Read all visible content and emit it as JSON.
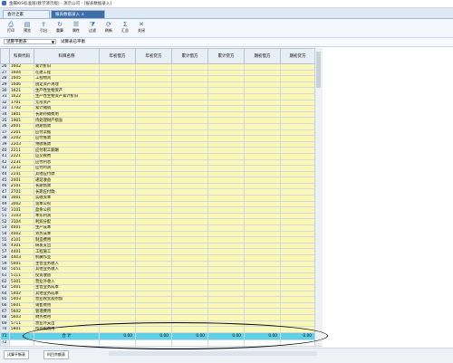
{
  "window": {
    "title": "金蝶KIS标准版(教学演示版) - 演示公司 - [报表数据录入]"
  },
  "tabs": [
    {
      "label": "会计之家"
    },
    {
      "label": "报表数据录入 ×"
    }
  ],
  "toolbar": [
    {
      "label": "打印",
      "icon": "printer-icon",
      "glyph": "⎙"
    },
    {
      "label": "预览",
      "icon": "preview-icon",
      "glyph": "▤"
    },
    {
      "label": "引出",
      "icon": "export-icon",
      "glyph": "⇪"
    },
    {
      "label": "重算",
      "icon": "recalc-icon",
      "glyph": "↻"
    },
    {
      "label": "属性",
      "icon": "properties-icon",
      "glyph": "☰"
    },
    {
      "label": "过滤",
      "icon": "filter-icon",
      "glyph": "⧩"
    },
    {
      "label": "刷新",
      "icon": "refresh-icon",
      "glyph": "⟳"
    },
    {
      "label": "汇总",
      "icon": "summary-icon",
      "glyph": "Σ"
    },
    {
      "label": "关闭",
      "icon": "close-icon",
      "glyph": "✕"
    }
  ],
  "filter": {
    "selected": "试算平衡表",
    "label": "试算表已平衡"
  },
  "columns": [
    "科目代码",
    "科目名称",
    "年初借方",
    "年初贷方",
    "累计借方",
    "累计贷方",
    "期初借方",
    "期初贷方"
  ],
  "rows": [
    {
      "n": "26",
      "code": "1602",
      "name": "累计折旧"
    },
    {
      "n": "27",
      "code": "1604",
      "name": "在建工程"
    },
    {
      "n": "28",
      "code": "1605",
      "name": "工程物资"
    },
    {
      "n": "29",
      "code": "1606",
      "name": "固定资产清理"
    },
    {
      "n": "30",
      "code": "1621",
      "name": "生产性生物资产"
    },
    {
      "n": "31",
      "code": "1622",
      "name": "生产性生物资产累计折旧"
    },
    {
      "n": "32",
      "code": "1701",
      "name": "无形资产"
    },
    {
      "n": "33",
      "code": "1702",
      "name": "累计摊销"
    },
    {
      "n": "34",
      "code": "1801",
      "name": "长期待摊费用"
    },
    {
      "n": "35",
      "code": "1901",
      "name": "待处理财产损溢"
    },
    {
      "n": "36",
      "code": "2001",
      "name": "短期借款"
    },
    {
      "n": "37",
      "code": "2201",
      "name": "应付票据"
    },
    {
      "n": "38",
      "code": "2202",
      "name": "应付账款"
    },
    {
      "n": "39",
      "code": "2203",
      "name": "预收账款"
    },
    {
      "n": "40",
      "code": "2211",
      "name": "应付职工薪酬"
    },
    {
      "n": "41",
      "code": "2221",
      "name": "应交税费"
    },
    {
      "n": "42",
      "code": "2231",
      "name": "应付利息"
    },
    {
      "n": "43",
      "code": "2232",
      "name": "应付利润"
    },
    {
      "n": "44",
      "code": "2241",
      "name": "其他应付款"
    },
    {
      "n": "45",
      "code": "2401",
      "name": "递延收益"
    },
    {
      "n": "46",
      "code": "2501",
      "name": "长期借款"
    },
    {
      "n": "47",
      "code": "2701",
      "name": "长期应付款"
    },
    {
      "n": "48",
      "code": "3001",
      "name": "实收资本"
    },
    {
      "n": "49",
      "code": "3002",
      "name": "资本公积"
    },
    {
      "n": "50",
      "code": "3101",
      "name": "盈余公积"
    },
    {
      "n": "51",
      "code": "3103",
      "name": "本年利润"
    },
    {
      "n": "52",
      "code": "3104",
      "name": "利润分配"
    },
    {
      "n": "53",
      "code": "4001",
      "name": "生产成本"
    },
    {
      "n": "54",
      "code": "4002",
      "name": "劳务成本"
    },
    {
      "n": "55",
      "code": "4101",
      "name": "制造费用"
    },
    {
      "n": "56",
      "code": "4301",
      "name": "研发支出"
    },
    {
      "n": "57",
      "code": "4401",
      "name": "工程施工"
    },
    {
      "n": "58",
      "code": "4403",
      "name": "机械作业"
    },
    {
      "n": "59",
      "code": "5001",
      "name": "主营业务收入"
    },
    {
      "n": "60",
      "code": "5051",
      "name": "其他业务收入"
    },
    {
      "n": "61",
      "code": "5111",
      "name": "投资收益"
    },
    {
      "n": "62",
      "code": "5301",
      "name": "营业外收入"
    },
    {
      "n": "63",
      "code": "5401",
      "name": "主营业务成本"
    },
    {
      "n": "64",
      "code": "5402",
      "name": "其他业务成本"
    },
    {
      "n": "65",
      "code": "5403",
      "name": "营业税金及附加"
    },
    {
      "n": "66",
      "code": "5601",
      "name": "销售费用"
    },
    {
      "n": "67",
      "code": "5602",
      "name": "管理费用"
    },
    {
      "n": "68",
      "code": "5603",
      "name": "财务费用"
    },
    {
      "n": "69",
      "code": "5711",
      "name": "营业外支出"
    },
    {
      "n": "70",
      "code": "5801",
      "name": "所得税费用"
    }
  ],
  "total": {
    "n": "71",
    "label": "合 计",
    "values": [
      "0.00",
      "0.00",
      "0.00",
      "0.00",
      "0.00",
      "0.00"
    ]
  },
  "blank_row": {
    "n": "72"
  },
  "status": {
    "sheet1": "试算平衡表",
    "sheet2": "科目余额表"
  },
  "colors": {
    "yellow_cell": "#faf8b4",
    "total_row": "#5fd0e6",
    "active_tab": "#3e6ea8"
  }
}
